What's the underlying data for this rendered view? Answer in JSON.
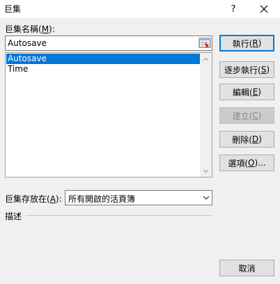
{
  "window": {
    "title": "巨集",
    "help": "?"
  },
  "macro_name": {
    "label": "巨集名稱(",
    "accel": "M",
    "label_end": "):",
    "value": "Autosave"
  },
  "macros": [
    {
      "name": "Autosave",
      "selected": true
    },
    {
      "name": "Time",
      "selected": false
    }
  ],
  "buttons": {
    "run": {
      "text": "執行(",
      "accel": "R",
      "end": ")"
    },
    "step": {
      "text": "逐步執行(",
      "accel": "S",
      "end": ")"
    },
    "edit": {
      "text": "編輯(",
      "accel": "E",
      "end": ")"
    },
    "create": {
      "text": "建立(",
      "accel": "C",
      "end": ")"
    },
    "delete": {
      "text": "刪除(",
      "accel": "D",
      "end": ")"
    },
    "options": {
      "text": "選項(",
      "accel": "O",
      "end": ")..."
    },
    "cancel": {
      "text": "取消"
    }
  },
  "macros_in": {
    "label": "巨集存放在(",
    "accel": "A",
    "label_end": "):",
    "selected": "所有開啟的活頁簿"
  },
  "description": {
    "label": "描述"
  },
  "colors": {
    "accent": "#0078d7",
    "background": "#f0f0f0"
  }
}
